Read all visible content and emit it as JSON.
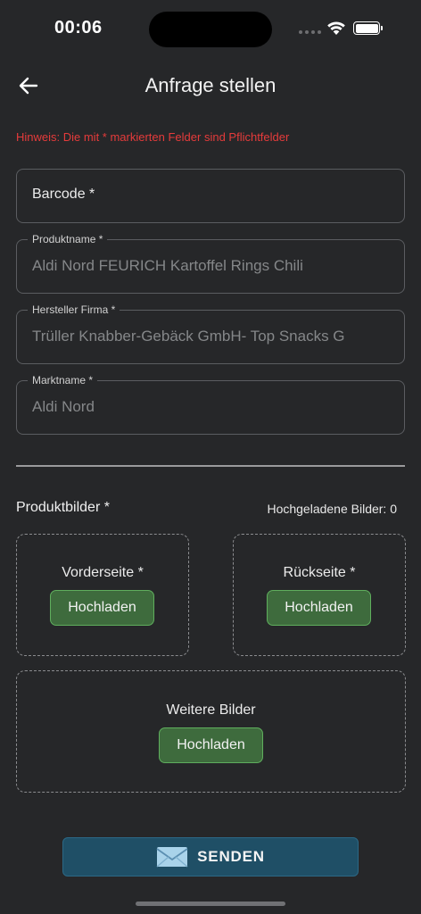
{
  "status_bar": {
    "time": "00:06"
  },
  "header": {
    "title": "Anfrage stellen"
  },
  "hint": "Hinweis: Die mit * markierten Felder sind Pflichtfelder",
  "fields": {
    "barcode": {
      "label": "Barcode *",
      "value": ""
    },
    "product_name": {
      "label": "Produktname *",
      "value": "Aldi Nord FEURICH Kartoffel Rings Chili"
    },
    "manufacturer": {
      "label": "Hersteller Firma *",
      "value": "Trüller Knabber-Gebäck GmbH- Top Snacks G"
    },
    "market": {
      "label": "Marktname *",
      "value": "Aldi Nord"
    }
  },
  "images": {
    "title": "Produktbilder *",
    "uploaded_count": "Hochgeladene Bilder: 0",
    "front": {
      "label": "Vorderseite *",
      "button": "Hochladen"
    },
    "back": {
      "label": "Rückseite *",
      "button": "Hochladen"
    },
    "more": {
      "label": "Weitere Bilder",
      "button": "Hochladen"
    }
  },
  "send_button": {
    "label": "SENDEN",
    "icon": "mail-icon"
  },
  "colors": {
    "background": "#262729",
    "hint": "#e53b3b",
    "upload_button": "#3e6b3d",
    "send_button": "#1f4f66"
  }
}
